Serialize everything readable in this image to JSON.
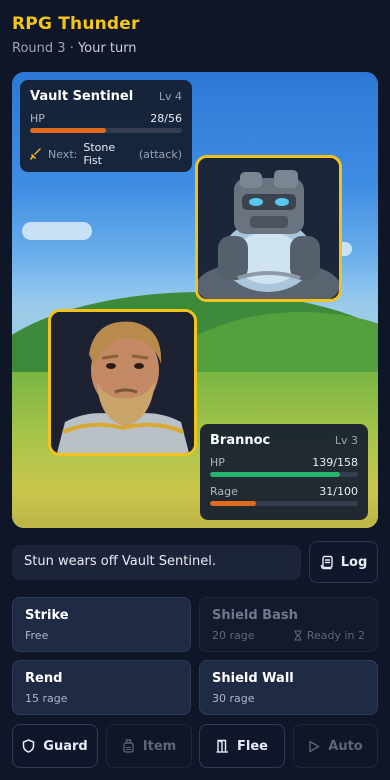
{
  "header": {
    "title": "RPG Thunder",
    "round": "Round 3",
    "separator": "·",
    "turn": "Your turn"
  },
  "enemy": {
    "name": "Vault Sentinel",
    "level": "Lv 4",
    "hp_label": "HP",
    "hp_text": "28/56",
    "hp_fraction": 0.5,
    "next_label": "Next:",
    "next_move": "Stone Fist",
    "next_type": "(attack)"
  },
  "hero": {
    "name": "Brannoc",
    "level": "Lv 3",
    "hp_label": "HP",
    "hp_text": "139/158",
    "hp_fraction": 0.88,
    "rage_label": "Rage",
    "rage_text": "31/100",
    "rage_fraction": 0.31
  },
  "log": {
    "message": "Stun wears off Vault Sentinel.",
    "button_label": "Log"
  },
  "actions": [
    {
      "name": "Strike",
      "cost": "Free",
      "enabled": true
    },
    {
      "name": "Shield Bash",
      "cost": "20 rage",
      "cooldown": "Ready in 2",
      "enabled": false
    },
    {
      "name": "Rend",
      "cost": "15 rage",
      "enabled": true
    },
    {
      "name": "Shield Wall",
      "cost": "30 rage",
      "enabled": true
    }
  ],
  "bottom": [
    {
      "label": "Guard",
      "icon": "shield-icon",
      "enabled": true
    },
    {
      "label": "Item",
      "icon": "potion-icon",
      "enabled": false
    },
    {
      "label": "Flee",
      "icon": "door-icon",
      "enabled": true
    },
    {
      "label": "Auto",
      "icon": "play-icon",
      "enabled": false
    }
  ],
  "colors": {
    "accent": "#f5c518",
    "enemy_hp": "#e06a1e",
    "hero_hp": "#27b36b",
    "rage": "#e06a1e"
  }
}
